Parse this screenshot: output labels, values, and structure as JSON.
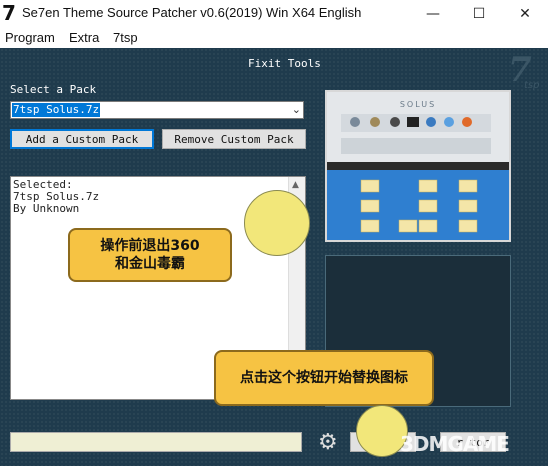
{
  "window": {
    "app_icon": "7",
    "title": "Se7en Theme Source Patcher v0.6(2019) Win X64 English",
    "minimize_glyph": "—",
    "maximize_glyph": "☐",
    "close_glyph": "✕"
  },
  "menu": {
    "items": [
      {
        "label": "Program"
      },
      {
        "label": "Extra"
      },
      {
        "label": "7tsp"
      }
    ]
  },
  "panel": {
    "title": "Fixit Tools",
    "logo_main": "7",
    "logo_sub": "tsp"
  },
  "pack": {
    "select_label": "Select a Pack",
    "selected_value": "7tsp Solus.7z",
    "add_button": "Add a Custom Pack",
    "remove_button": "Remove Custom Pack"
  },
  "info": {
    "lines": [
      "Selected:",
      "7tsp Solus.7z",
      "By Unknown"
    ]
  },
  "preview": {
    "title": "SOLUS"
  },
  "bottom": {
    "apply_label": "t",
    "restore_label": "r tor"
  },
  "annotations": {
    "callout1_line1": "操作前退出360",
    "callout1_line2": "和金山毒霸",
    "callout2": "点击这个按钮开始替换图标",
    "watermark": "3DMGAME"
  },
  "colors": {
    "panel_bg": "#1f3b4d",
    "callout_bg": "#f6c343",
    "accent": "#0078d7"
  }
}
